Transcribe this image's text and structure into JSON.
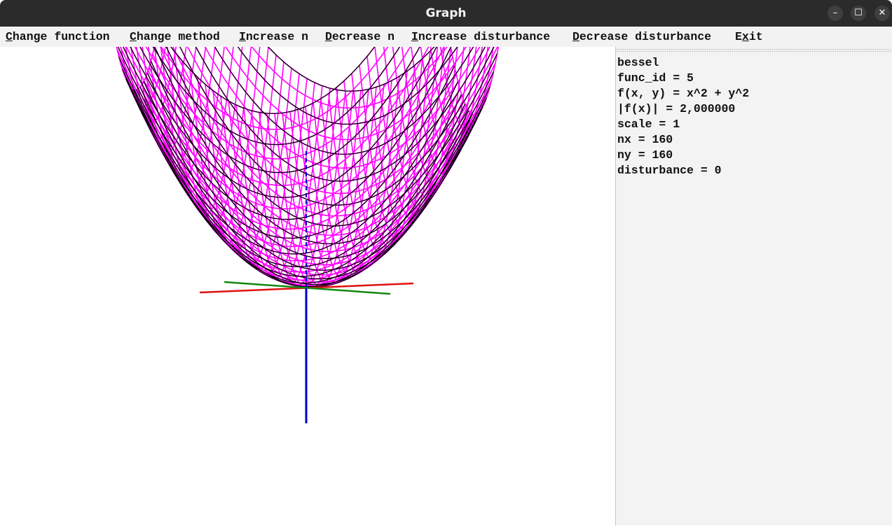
{
  "window": {
    "title": "Graph",
    "controls": {
      "minimize": "–",
      "maximize": "☐",
      "close": "✕"
    }
  },
  "menu": [
    {
      "mnemonic": "C",
      "rest": "hange function"
    },
    {
      "mnemonic": "C",
      "rest": "hange method"
    },
    {
      "mnemonic": "I",
      "rest": "ncrease n"
    },
    {
      "mnemonic": "D",
      "rest": "ecrease n"
    },
    {
      "mnemonic": "I",
      "rest": "ncrease disturbance"
    },
    {
      "mnemonic": "D",
      "rest": "ecrease disturbance"
    },
    {
      "pre": "E",
      "mnemonic": "x",
      "rest": "it"
    }
  ],
  "info": {
    "lines": [
      "bessel",
      "func_id = 5",
      "f(x, y) = x^2 + y^2",
      "|f(x)| = 2,000000",
      "scale = 1",
      "nx = 160",
      "ny = 160",
      "disturbance = 0"
    ]
  },
  "plot": {
    "colors": {
      "surface_primary": "#ff00ff",
      "surface_secondary": "#000000",
      "axis_x": "#e01010",
      "axis_y": "#118811",
      "axis_z": "#0000cc",
      "panel_bg": "#f3f3f3",
      "titlebar_bg": "#2b2b2b"
    }
  }
}
